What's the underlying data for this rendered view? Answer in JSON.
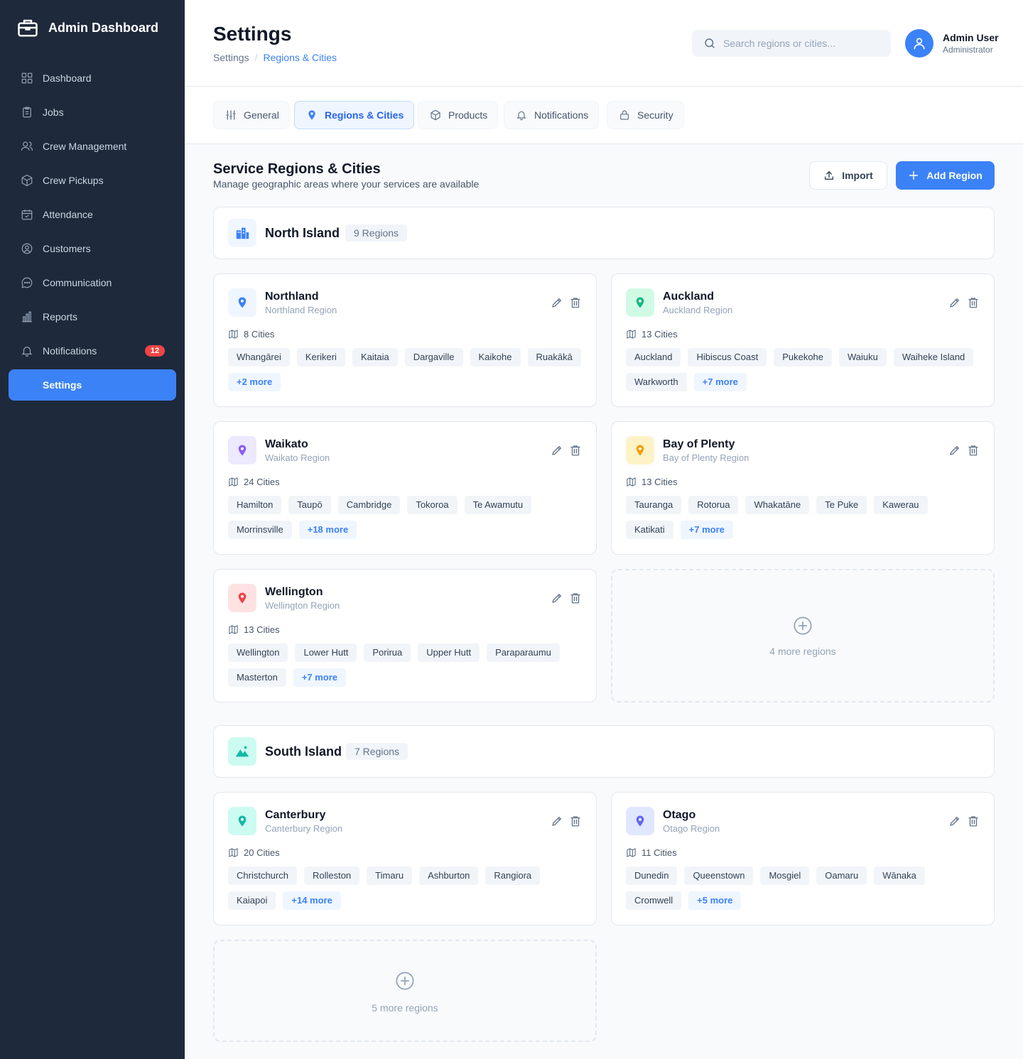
{
  "app": {
    "title": "Admin Dashboard"
  },
  "sidebar": {
    "items": [
      {
        "label": "Dashboard",
        "icon": "grid-icon"
      },
      {
        "label": "Jobs",
        "icon": "clipboard-icon"
      },
      {
        "label": "Crew Management",
        "icon": "users-icon"
      },
      {
        "label": "Crew Pickups",
        "icon": "box-icon"
      },
      {
        "label": "Attendance",
        "icon": "calendar-icon"
      },
      {
        "label": "Customers",
        "icon": "user-circle-icon"
      },
      {
        "label": "Communication",
        "icon": "chat-icon"
      },
      {
        "label": "Reports",
        "icon": "bar-chart-icon"
      },
      {
        "label": "Notifications",
        "icon": "bell-icon",
        "badge": "12"
      },
      {
        "label": "Settings",
        "active": true
      }
    ]
  },
  "header": {
    "title": "Settings",
    "breadcrumb": [
      "Settings",
      "Regions & Cities"
    ],
    "search_placeholder": "Search regions or cities...",
    "user": {
      "name": "Admin User",
      "role": "Administrator"
    }
  },
  "tabs": [
    {
      "label": "General",
      "icon": "sliders-icon"
    },
    {
      "label": "Regions & Cities",
      "icon": "map-pin-icon",
      "active": true
    },
    {
      "label": "Products",
      "icon": "box-icon"
    },
    {
      "label": "Notifications",
      "icon": "bell-icon"
    },
    {
      "label": "Security",
      "icon": "lock-icon"
    }
  ],
  "section": {
    "title": "Service Regions & Cities",
    "subtitle": "Manage geographic areas where your services are available",
    "import_label": "Import",
    "add_label": "Add Region"
  },
  "islands": [
    {
      "name": "North Island",
      "count": "9 Regions",
      "icon": "buildings-icon",
      "color": "#3b82f6",
      "regions": [
        {
          "name": "Northland",
          "sub": "Northland Region",
          "count": "8 Cities",
          "color": "#3b82f6",
          "cities": [
            "Whangārei",
            "Kerikeri",
            "Kaitaia",
            "Dargaville",
            "Kaikohe",
            "Ruakākā"
          ],
          "more": "+2 more"
        },
        {
          "name": "Auckland",
          "sub": "Auckland Region",
          "count": "13 Cities",
          "color": "#10b981",
          "cities": [
            "Auckland",
            "Hibiscus Coast",
            "Pukekohe",
            "Waiuku",
            "Waiheke Island",
            "Warkworth"
          ],
          "more": "+7 more"
        },
        {
          "name": "Waikato",
          "sub": "Waikato Region",
          "count": "24 Cities",
          "color": "#8b5cf6",
          "cities": [
            "Hamilton",
            "Taupō",
            "Cambridge",
            "Tokoroa",
            "Te Awamutu",
            "Morrinsville"
          ],
          "more": "+18 more"
        },
        {
          "name": "Bay of Plenty",
          "sub": "Bay of Plenty Region",
          "count": "13 Cities",
          "color": "#f59e0b",
          "cities": [
            "Tauranga",
            "Rotorua",
            "Whakatāne",
            "Te Puke",
            "Kawerau",
            "Katikati"
          ],
          "more": "+7 more"
        },
        {
          "name": "Wellington",
          "sub": "Wellington Region",
          "count": "13 Cities",
          "color": "#ef4444",
          "cities": [
            "Wellington",
            "Lower Hutt",
            "Porirua",
            "Upper Hutt",
            "Paraparaumu",
            "Masterton"
          ],
          "more": "+7 more"
        }
      ],
      "more_regions": "4 more regions"
    },
    {
      "name": "South Island",
      "count": "7 Regions",
      "icon": "mountain-icon",
      "color": "#14b8a6",
      "regions": [
        {
          "name": "Canterbury",
          "sub": "Canterbury Region",
          "count": "20 Cities",
          "color": "#14b8a6",
          "cities": [
            "Christchurch",
            "Rolleston",
            "Timaru",
            "Ashburton",
            "Rangiora",
            "Kaiapoi"
          ],
          "more": "+14 more"
        },
        {
          "name": "Otago",
          "sub": "Otago Region",
          "count": "11 Cities",
          "color": "#6366f1",
          "cities": [
            "Dunedin",
            "Queenstown",
            "Mosgiel",
            "Oamaru",
            "Wānaka",
            "Cromwell"
          ],
          "more": "+5 more"
        }
      ],
      "more_regions": "5 more regions"
    }
  ]
}
